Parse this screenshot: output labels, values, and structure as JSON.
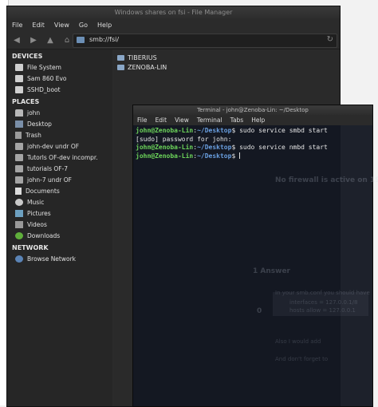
{
  "file_manager": {
    "title": "Windows shares on fsi - File Manager",
    "menu": [
      "File",
      "Edit",
      "View",
      "Go",
      "Help"
    ],
    "location": "smb://fsi/",
    "sidebar": {
      "devices_header": "DEVICES",
      "devices": [
        {
          "label": "File System",
          "icon": "drive-icon"
        },
        {
          "label": "Sam 860 Evo",
          "icon": "drive-icon"
        },
        {
          "label": "SSHD_boot",
          "icon": "drive-icon"
        }
      ],
      "places_header": "PLACES",
      "places": [
        {
          "label": "john",
          "icon": "home-icon"
        },
        {
          "label": "Desktop",
          "icon": "desktop-icon"
        },
        {
          "label": "Trash",
          "icon": "trash-icon"
        },
        {
          "label": "john-dev undr OF",
          "icon": "folder-icon"
        },
        {
          "label": "Tutorls OF-dev incompr.",
          "icon": "folder-icon"
        },
        {
          "label": "tutorials OF-7",
          "icon": "folder-icon"
        },
        {
          "label": "john-7 undr OF",
          "icon": "folder-icon"
        },
        {
          "label": "Documents",
          "icon": "documents-icon"
        },
        {
          "label": "Music",
          "icon": "music-icon"
        },
        {
          "label": "Pictures",
          "icon": "pictures-icon"
        },
        {
          "label": "Videos",
          "icon": "videos-icon"
        },
        {
          "label": "Downloads",
          "icon": "downloads-icon"
        }
      ],
      "network_header": "NETWORK",
      "network": [
        {
          "label": "Browse Network",
          "icon": "network-icon"
        }
      ]
    },
    "entries": [
      "TIBERIUS",
      "ZENOBA-LIN"
    ]
  },
  "terminal": {
    "title": "Terminal - john@Zenoba-Lin: ~/Desktop",
    "menu": [
      "File",
      "Edit",
      "View",
      "Terminal",
      "Tabs",
      "Help"
    ],
    "prompt_user": "john@Zenoba-Lin",
    "prompt_path": "~/Desktop",
    "lines": [
      {
        "type": "cmd",
        "text": "sudo service smbd start"
      },
      {
        "type": "out",
        "text": "[sudo] password for john:"
      },
      {
        "type": "cmd",
        "text": "sudo service nmbd start"
      },
      {
        "type": "cmd",
        "text": ""
      }
    ]
  },
  "background_ghost": {
    "lines": [
      "No firewall is active on 192.168",
      "1 Answer",
      "In your smb.conf you should have",
      "interfaces = 127.0.0.1/8",
      "hosts allow = 127.0.0.1",
      "Also I would add",
      "And don't forget to"
    ],
    "vote": "0"
  },
  "colors": {
    "prompt_user": "#6cd45a",
    "prompt_path": "#6a9fe0"
  }
}
